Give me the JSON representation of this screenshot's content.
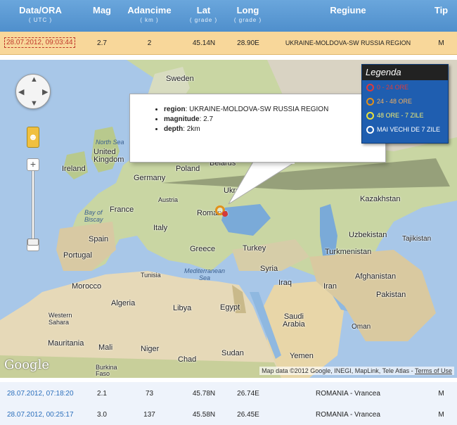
{
  "header": {
    "date": {
      "title": "Data/ORA",
      "sub": "( UTC )"
    },
    "mag": {
      "title": "Mag"
    },
    "depth": {
      "title": "Adancime",
      "sub": "( km )"
    },
    "lat": {
      "title": "Lat",
      "sub": "( grade )"
    },
    "long": {
      "title": "Long",
      "sub": "( grade )"
    },
    "region": {
      "title": "Regiune"
    },
    "type": {
      "title": "Tip"
    }
  },
  "rows": [
    {
      "date": "28.07.2012, 09:03:44",
      "mag": "2.7",
      "depth": "2",
      "lat": "45.14N",
      "long": "28.90E",
      "region": "UKRAINE-MOLDOVA-SW RUSSIA REGION",
      "type": "M"
    },
    {
      "date": "28.07.2012, 07:18:20",
      "mag": "2.1",
      "depth": "73",
      "lat": "45.78N",
      "long": "26.74E",
      "region": "ROMANIA - Vrancea",
      "type": "M"
    },
    {
      "date": "28.07.2012, 00:25:17",
      "mag": "3.0",
      "depth": "137",
      "lat": "45.58N",
      "long": "26.45E",
      "region": "ROMANIA - Vrancea",
      "type": "M"
    }
  ],
  "legend": {
    "title": "Legenda",
    "items": [
      {
        "label": "0 - 24 ORE",
        "color": "#e03a3a"
      },
      {
        "label": "24 - 48 ORE",
        "color": "#e2901a"
      },
      {
        "label": "48 ORE - 7 ZILE",
        "color": "#e8e23a"
      },
      {
        "label": "MAI VECHI DE 7 ZILE",
        "color": "#ffffff"
      }
    ]
  },
  "infowindow": {
    "region_key": "region",
    "region_val": "UKRAINE-MOLDOVA-SW RUSSIA REGION",
    "magnitude_key": "magnitude",
    "magnitude_val": "2.7",
    "depth_key": "depth",
    "depth_val": "2km"
  },
  "map": {
    "labels": {
      "sweden": "Sweden",
      "north_sea": "North Sea",
      "united_kingdom": "United\nKingdom",
      "ireland": "Ireland",
      "poland": "Poland",
      "belarus": "Belarus",
      "germany": "Germany",
      "ukraine": "Ukrai",
      "bay_of_biscay": "Bay of\nBiscay",
      "france": "France",
      "austria": "Austria",
      "romania": "Romania",
      "italy": "Italy",
      "spain": "Spain",
      "portugal": "Portugal",
      "greece": "Greece",
      "turkey": "Turkey",
      "kazakhstan": "Kazakhstan",
      "uzbekistan": "Uzbekistan",
      "turkmenistan": "Turkmenistan",
      "tajikistan": "Tajikistan",
      "syria": "Syria",
      "iraq": "Iraq",
      "iran": "Iran",
      "afghanistan": "Afghanistan",
      "pakistan": "Pakistan",
      "morocco": "Morocco",
      "tunisia": "Tunisia",
      "mediterranean_sea": "Mediterranean\nSea",
      "algeria": "Algeria",
      "libya": "Libya",
      "egypt": "Egypt",
      "saudi_arabia": "Saudi\nArabia",
      "western_sahara": "Western\nSahara",
      "mauritania": "Mauritania",
      "mali": "Mali",
      "niger": "Niger",
      "chad": "Chad",
      "sudan": "Sudan",
      "yemen": "Yemen",
      "oman": "Oman",
      "burkina_faso": "Burkina\nFaso"
    },
    "google": "Google",
    "attribution": "Map data ©2012 Google, INEGI, MapLink, Tele Atlas - ",
    "terms": "Terms of Use"
  }
}
